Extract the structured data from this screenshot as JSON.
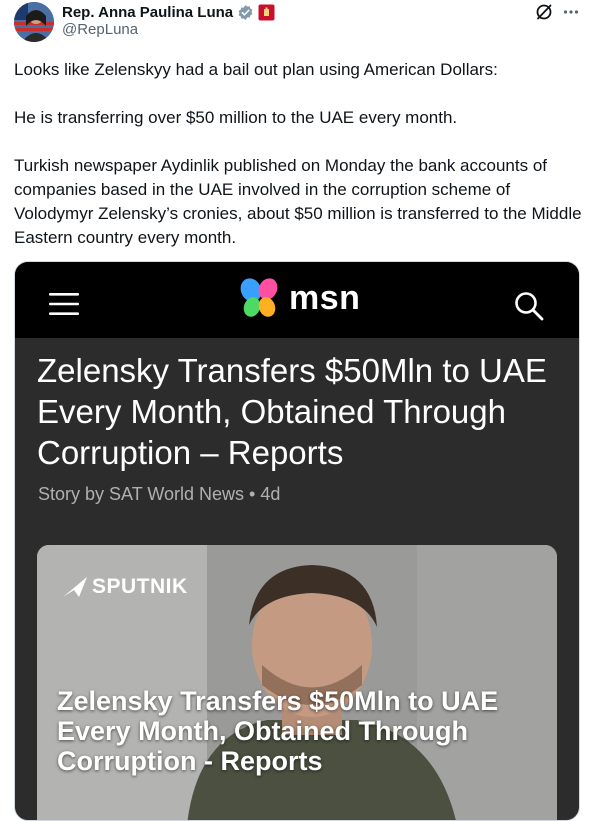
{
  "author": {
    "display_name": "Rep. Anna Paulina Luna",
    "handle": "@RepLuna"
  },
  "tweet": {
    "paragraphs": [
      "Looks like Zelenskyy had a bail out plan using American Dollars:",
      "He is transferring over $50 million to the UAE every month.",
      "Turkish newspaper Aydinlik published on Monday the bank accounts of companies based in the UAE involved in the corruption scheme of Volodymyr Zelensky’s cronies, about $50 million is transferred to the Middle Eastern country every month."
    ]
  },
  "card": {
    "site_name": "msn",
    "headline": "Zelensky Transfers $50Mln to UAE Every Month, Obtained Through Corruption – Reports",
    "byline": "Story by SAT World News • 4d",
    "image": {
      "source_logo": "SPUTNIK",
      "overlay_title": "Zelensky Transfers $50Mln to UAE Every Month, Obtained Through Corruption - Reports"
    }
  },
  "icons": {
    "verified": "verified-badge-icon",
    "affiliation": "affiliation-flag-icon",
    "grok": "grok-icon",
    "more": "more-options-icon",
    "menu": "hamburger-icon",
    "search": "search-icon"
  },
  "colors": {
    "text_primary": "#0f1419",
    "text_secondary": "#536471",
    "verified_gray": "#829aab",
    "affiliation_red": "#c8102e",
    "msn_bar": "#000000",
    "card_bg": "#2c2c2c"
  }
}
